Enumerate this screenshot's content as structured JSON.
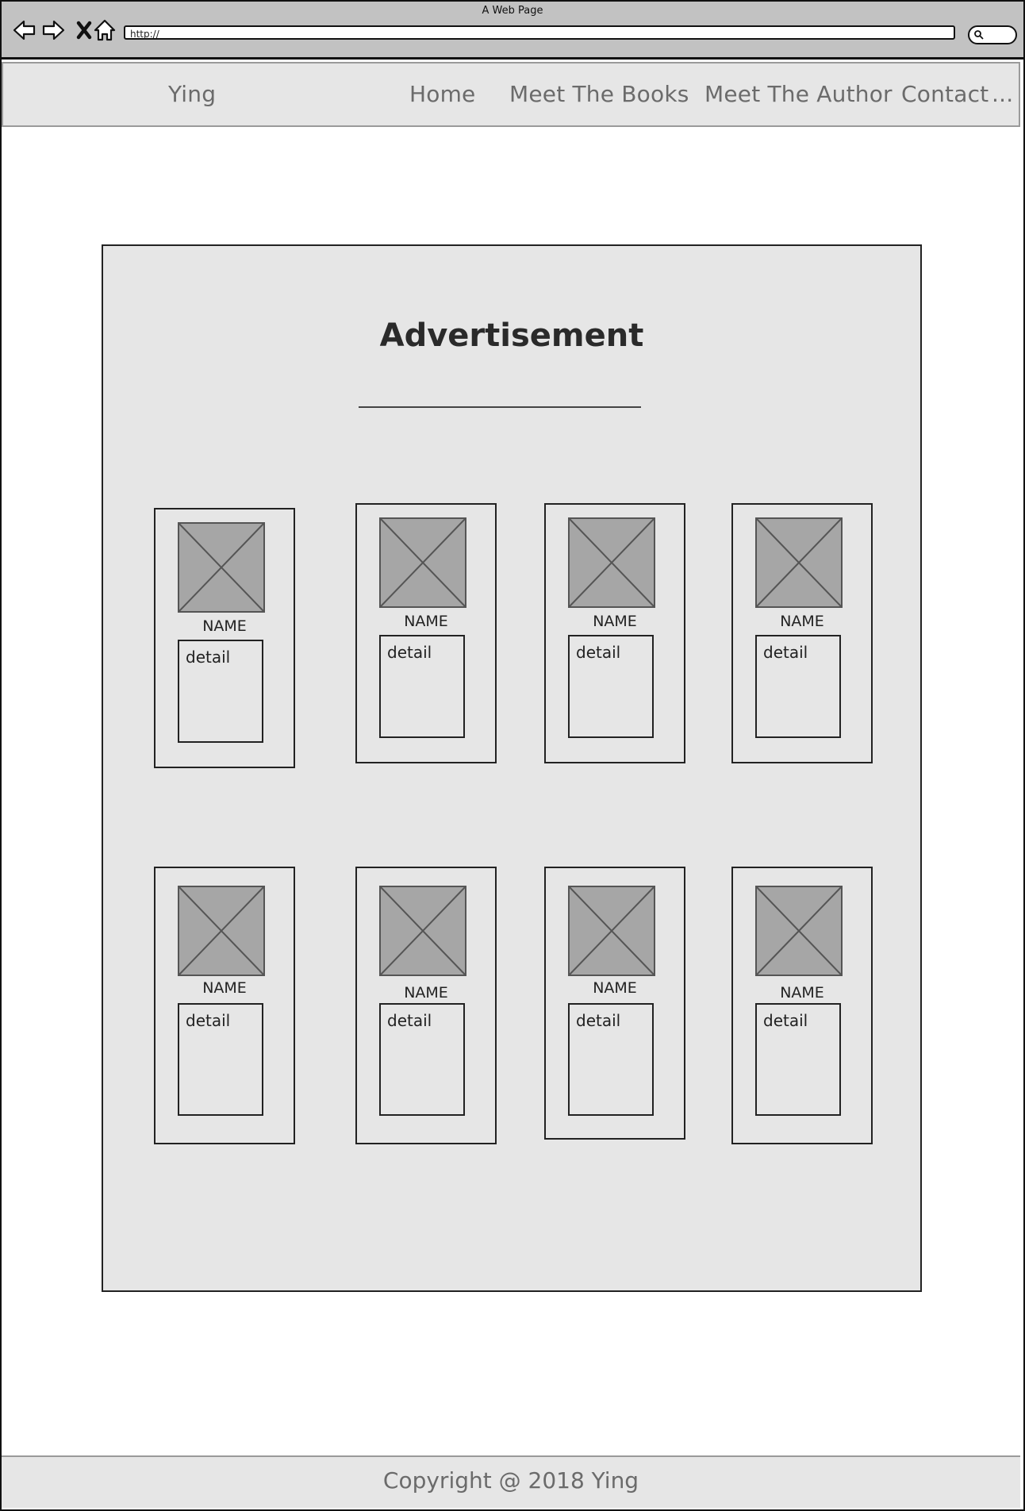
{
  "browser": {
    "title": "A Web Page",
    "url": "http://",
    "icons": [
      "back-arrow-icon",
      "forward-arrow-icon",
      "close-icon",
      "home-icon",
      "search-icon"
    ]
  },
  "navbar": {
    "brand": "Ying",
    "links": [
      "Home",
      "Meet The Books",
      "Meet The Author",
      "Contact"
    ],
    "more": "..."
  },
  "main": {
    "title": "Advertisement",
    "cards": [
      {
        "name": "NAME",
        "detail": "detail"
      },
      {
        "name": "NAME",
        "detail": "detail"
      },
      {
        "name": "NAME",
        "detail": "detail"
      },
      {
        "name": "NAME",
        "detail": "detail"
      },
      {
        "name": "NAME",
        "detail": "detail"
      },
      {
        "name": "NAME",
        "detail": "detail"
      },
      {
        "name": "NAME",
        "detail": "detail"
      },
      {
        "name": "NAME",
        "detail": "detail"
      }
    ]
  },
  "footer": {
    "copyright": "Copyright @ 2018 Ying"
  }
}
